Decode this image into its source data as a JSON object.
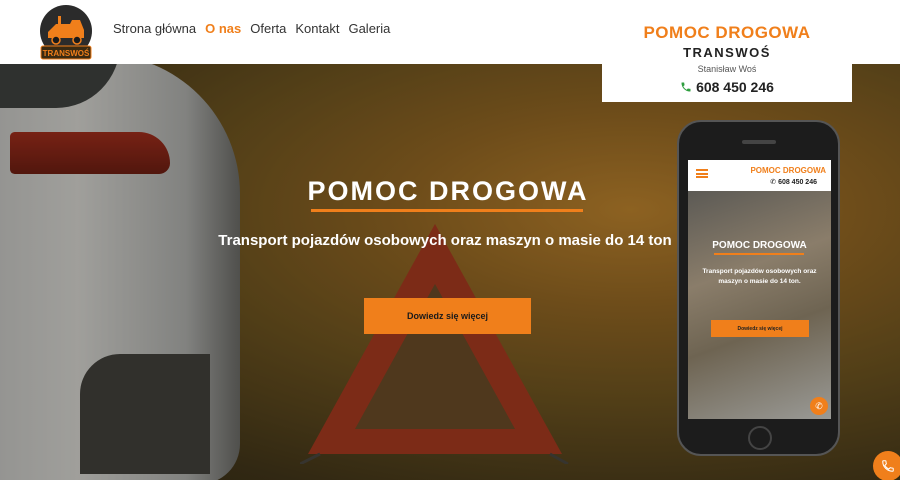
{
  "header": {
    "logo_text": "TRANSWOŚ",
    "nav": [
      {
        "label": "Strona główna",
        "active": false
      },
      {
        "label": "O nas",
        "active": true
      },
      {
        "label": "Oferta",
        "active": false
      },
      {
        "label": "Kontakt",
        "active": false
      },
      {
        "label": "Galeria",
        "active": false
      }
    ]
  },
  "info_box": {
    "title": "POMOC DROGOWA",
    "company": "TRANSWOŚ",
    "owner": "Stanisław Woś",
    "phone": "608 450 246",
    "phone_icon": "phone-icon"
  },
  "hero": {
    "title": "POMOC DROGOWA",
    "subtitle": "Transport pojazdów osobowych oraz maszyn o masie do 14 ton",
    "cta_label": "Dowiedz się więcej"
  },
  "mobile_preview": {
    "brand": "POMOC DROGOWA",
    "phone": "608 450 246",
    "title": "POMOC DROGOWA",
    "subtitle": "Transport pojazdów osobowych oraz maszyn o masie do 14 ton.",
    "cta_label": "Dowiedz się więcej"
  },
  "colors": {
    "accent": "#f07f1b",
    "header_bg": "#ffffff",
    "text_dark": "#222222"
  },
  "fab": {
    "icon": "phone-icon"
  }
}
